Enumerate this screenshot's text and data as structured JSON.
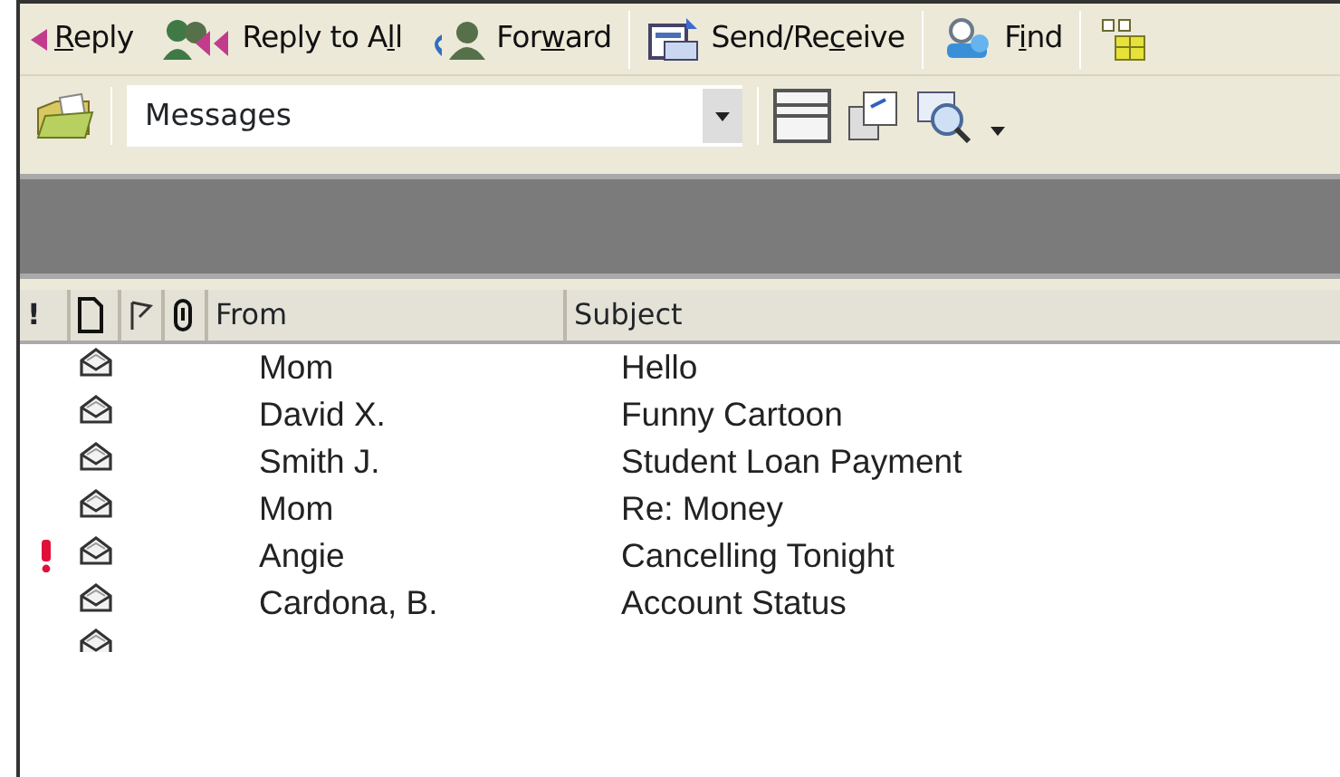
{
  "toolbar": [
    {
      "kind": "reply",
      "label_parts": [
        {
          "text": "R",
          "underlined": true
        },
        {
          "text": "eply",
          "underlined": false
        }
      ]
    },
    {
      "kind": "reply-all",
      "label_parts": [
        {
          "text": "Reply to A",
          "underlined": false
        },
        {
          "text": "l",
          "underlined": true
        },
        {
          "text": "l",
          "underlined": false
        }
      ]
    },
    {
      "kind": "forward",
      "label_parts": [
        {
          "text": "For",
          "underlined": false
        },
        {
          "text": "w",
          "underlined": true
        },
        {
          "text": "ard",
          "underlined": false
        }
      ]
    },
    {
      "kind": "send-receive",
      "label_parts": [
        {
          "text": "Send/Re",
          "underlined": false
        },
        {
          "text": "c",
          "underlined": true
        },
        {
          "text": "eive",
          "underlined": false
        }
      ]
    },
    {
      "kind": "find",
      "label_parts": [
        {
          "text": "F",
          "underlined": false
        },
        {
          "text": "i",
          "underlined": true
        },
        {
          "text": "nd",
          "underlined": false
        }
      ]
    },
    {
      "kind": "org"
    }
  ],
  "folder_combo": {
    "value": "Messages"
  },
  "table": {
    "columns": [
      {
        "kind": "importance",
        "label": "!"
      },
      {
        "kind": "icon"
      },
      {
        "kind": "flag"
      },
      {
        "kind": "attachment"
      },
      {
        "kind": "text",
        "label": "From"
      },
      {
        "kind": "text",
        "label": "Subject"
      }
    ],
    "rows": [
      {
        "from": "Mom",
        "subject": "Hello",
        "important": false
      },
      {
        "from": "David X.",
        "subject": "Funny Cartoon",
        "important": false
      },
      {
        "from": "Smith J.",
        "subject": "Student Loan Payment",
        "important": false
      },
      {
        "from": "Mom",
        "subject": "Re: Money",
        "important": false
      },
      {
        "from": "Angie",
        "subject": "Cancelling Tonight",
        "important": true
      },
      {
        "from": "Cardona, B.",
        "subject": "Account Status",
        "important": false
      }
    ]
  }
}
